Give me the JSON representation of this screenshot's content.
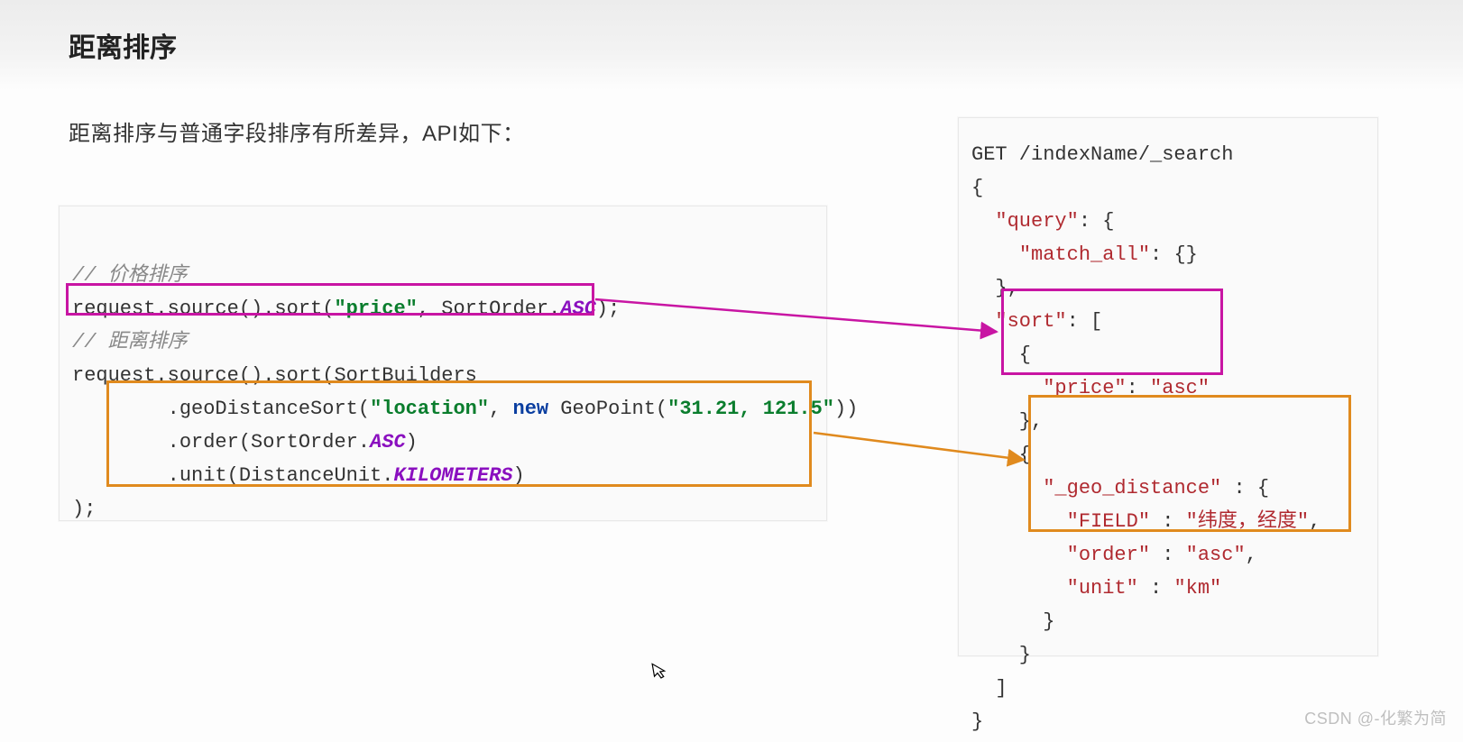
{
  "title": "距离排序",
  "subtitle": "距离排序与普通字段排序有所差异，API如下：",
  "left_code": {
    "comment_price": "// 价格排序",
    "line_price_pre": "request.source().sort(",
    "line_price_str": "\"price\"",
    "line_price_mid": ", SortOrder.",
    "line_price_const": "ASC",
    "line_price_end": ");",
    "comment_dist": "// 距离排序",
    "l3": "request.source().sort(SortBuilders",
    "l4_pre": "        .geoDistanceSort(",
    "l4_str1": "\"location\"",
    "l4_mid": ", ",
    "l4_kw": "new",
    "l4_mid2": " GeoPoint(",
    "l4_str2": "\"31.21, 121.5\"",
    "l4_end": "))",
    "l5_pre": "        .order(SortOrder.",
    "l5_const": "ASC",
    "l5_end": ")",
    "l6_pre": "        .unit(DistanceUnit.",
    "l6_const": "KILOMETERS",
    "l6_end": ")",
    "l7": ");"
  },
  "right_code": {
    "l1": "GET /indexName/_search",
    "l2": "{",
    "l3a": "  ",
    "l3k": "\"query\"",
    "l3b": ": {",
    "l4a": "    ",
    "l4k": "\"match_all\"",
    "l4b": ": {}",
    "l5": "  },",
    "l6a": "  ",
    "l6k": "\"sort\"",
    "l6b": ": [",
    "l7": "    {",
    "l8a": "      ",
    "l8k": "\"price\"",
    "l8b": ": ",
    "l8v": "\"asc\"",
    "l9": "    },",
    "l10": "    {",
    "l11a": "      ",
    "l11k": "\"_geo_distance\"",
    "l11b": " : {",
    "l12a": "        ",
    "l12k": "\"FIELD\"",
    "l12b": " : ",
    "l12v": "\"纬度，经度\"",
    "l12c": ",",
    "l13a": "        ",
    "l13k": "\"order\"",
    "l13b": " : ",
    "l13v": "\"asc\"",
    "l13c": ",",
    "l14a": "        ",
    "l14k": "\"unit\"",
    "l14b": " : ",
    "l14v": "\"km\"",
    "l15": "      }",
    "l16": "    }",
    "l17": "  ]",
    "l18": "}"
  },
  "watermark": "CSDN @-化繁为简",
  "colors": {
    "magenta": "#c815a3",
    "orange": "#e08a1e"
  }
}
